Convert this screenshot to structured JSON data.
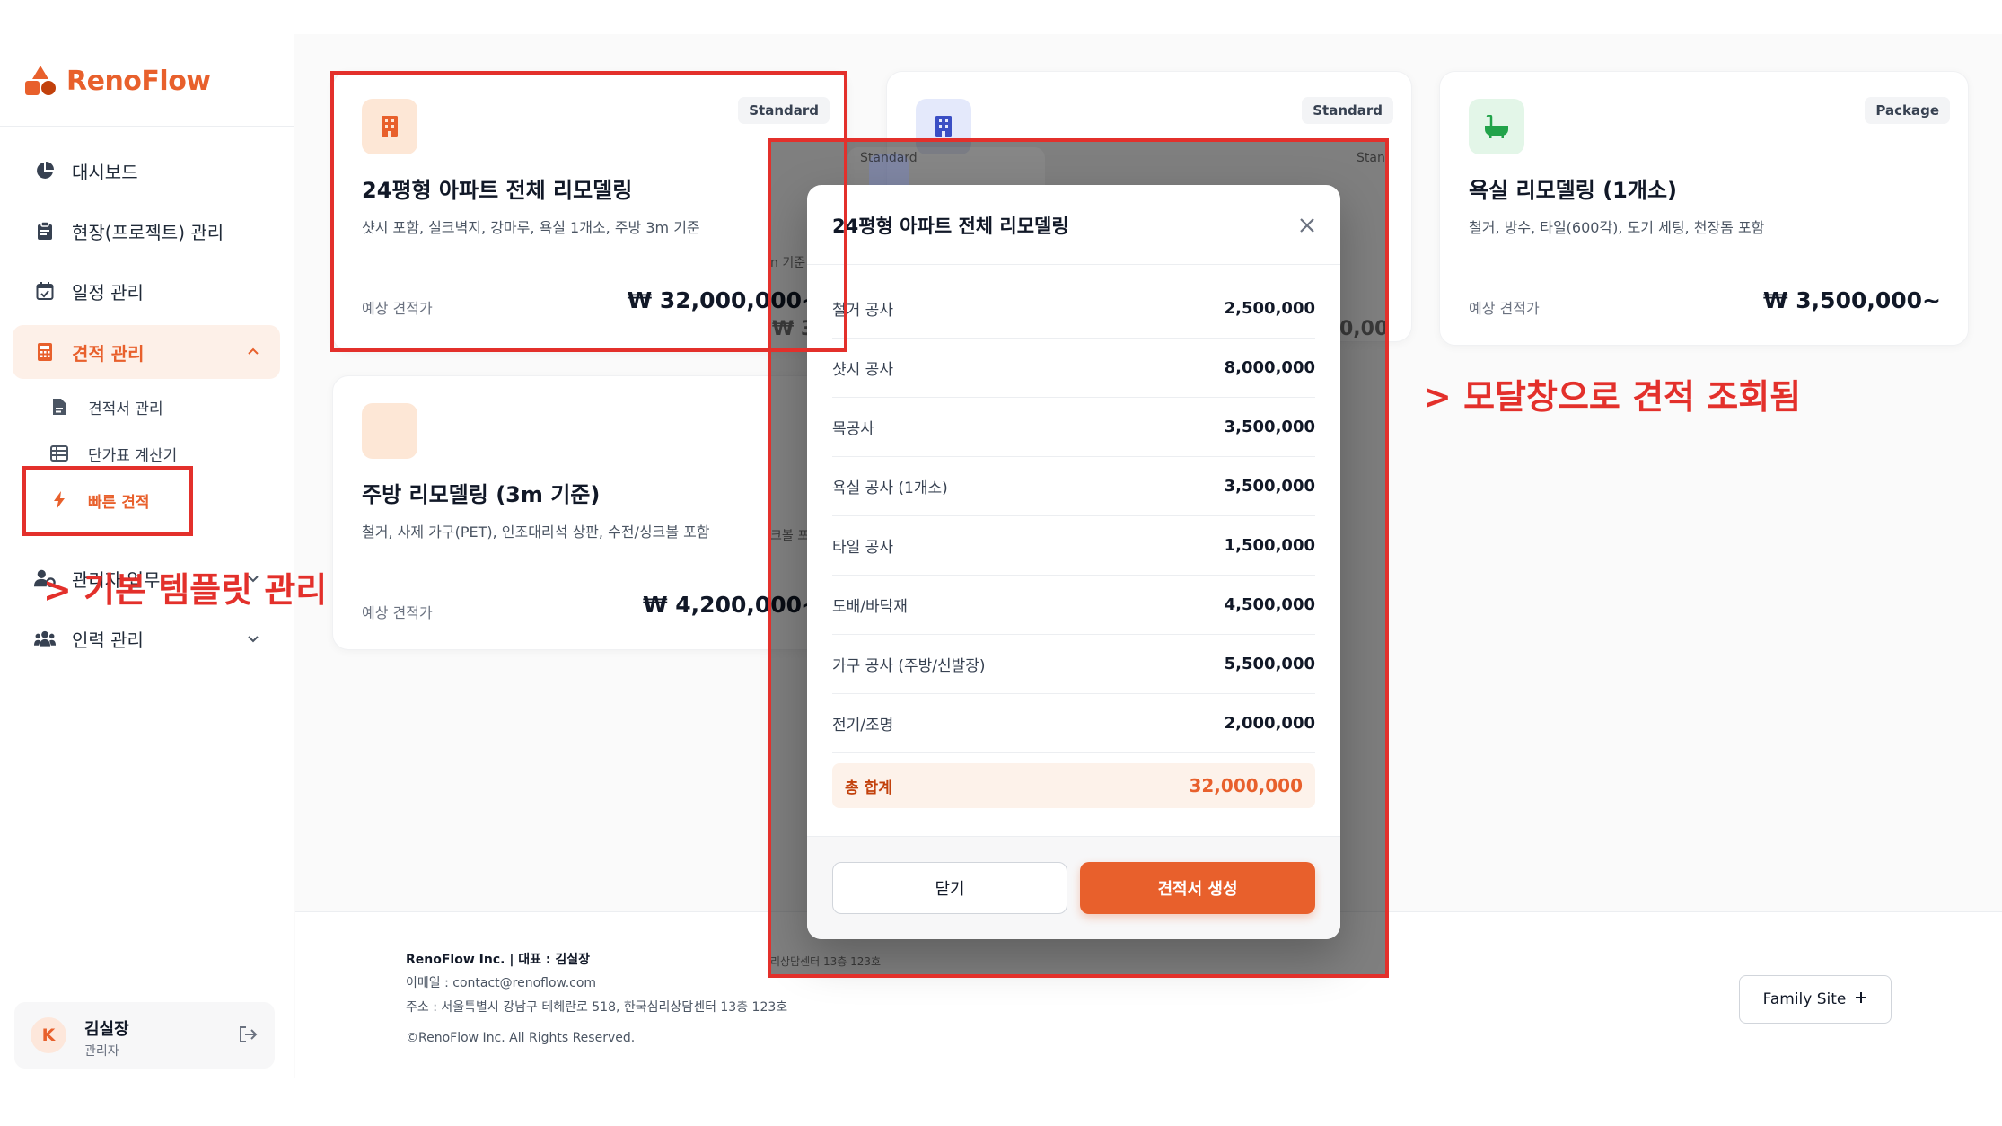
{
  "brand": {
    "name": "RenoFlow"
  },
  "sidebar": {
    "items": [
      {
        "label": "대시보드",
        "icon": "pie-chart-icon"
      },
      {
        "label": "현장(프로젝트) 관리",
        "icon": "clipboard-icon"
      },
      {
        "label": "일정 관리",
        "icon": "calendar-icon"
      },
      {
        "label": "견적 관리",
        "icon": "calculator-icon",
        "expanded": true
      },
      {
        "label": "관리자 업무",
        "icon": "user-gear-icon"
      },
      {
        "label": "인력 관리",
        "icon": "users-icon"
      }
    ],
    "subitems": [
      {
        "label": "견적서 관리",
        "icon": "document-icon"
      },
      {
        "label": "단가표 계산기",
        "icon": "table-icon"
      },
      {
        "label": "빠른 견적",
        "icon": "bolt-icon",
        "active": true
      }
    ],
    "user": {
      "initial": "K",
      "name": "김실장",
      "role": "관리자"
    }
  },
  "cards": [
    {
      "badge": "Standard",
      "title": "24평형 아파트 전체 리모델링",
      "desc": "샷시 포함, 실크벽지, 강마루, 욕실 1개소, 주방 3m 기준",
      "price_label": "예상 견적가",
      "price": "₩ 32,000,000~",
      "icon": "building-icon"
    },
    {
      "badge": "Standard",
      "title": "",
      "desc": "",
      "price_label": "",
      "price": "",
      "icon": "building-icon"
    },
    {
      "badge": "Package",
      "title": "욕실 리모델링 (1개소)",
      "desc": "철거, 방수, 타일(600각), 도기 세팅, 천장돔 포함",
      "price_label": "예상 견적가",
      "price": "₩ 3,500,000~",
      "icon": "bathtub-icon"
    },
    {
      "badge": "",
      "title": "주방 리모델링 (3m 기준)",
      "desc": "철거, 사제 가구(PET), 인조대리석 상판, 수전/싱크볼 포함",
      "price_label": "예상 견적가",
      "price": "₩ 4,200,000~",
      "icon": ""
    }
  ],
  "footer": {
    "company": "RenoFlow Inc. | 대표 : 김실장",
    "email": "이메일 : contact@renoflow.com",
    "address": "주소 : 서울특별시 강남구 테헤란로 518, 한국심리상담센터 13층 123호",
    "copyright": "©RenoFlow Inc. All Rights Reserved.",
    "family_site": "Family Site"
  },
  "ghost_text": {
    "badge_left": "Standard",
    "badge_right": "Stan",
    "frag1": "n 기준",
    "frag2": "₩ 3",
    "frag3": "0,00",
    "frag4": "크볼 포",
    "frag5": "리상담센터 13층 123호"
  },
  "modal": {
    "title": "24평형 아파트 전체 리모델링",
    "items": [
      {
        "name": "철거 공사",
        "amount": "2,500,000"
      },
      {
        "name": "샷시 공사",
        "amount": "8,000,000"
      },
      {
        "name": "목공사",
        "amount": "3,500,000"
      },
      {
        "name": "욕실 공사 (1개소)",
        "amount": "3,500,000"
      },
      {
        "name": "타일 공사",
        "amount": "1,500,000"
      },
      {
        "name": "도배/바닥재",
        "amount": "4,500,000"
      },
      {
        "name": "가구 공사 (주방/신발장)",
        "amount": "5,500,000"
      },
      {
        "name": "전기/조명",
        "amount": "2,000,000"
      }
    ],
    "total_label": "총 합계",
    "total_amount": "32,000,000",
    "close_label": "닫기",
    "create_label": "견적서 생성"
  },
  "annotations": {
    "left": "> 기본 템플릿 관리",
    "right": "> 모달창으로 견적 조회됨",
    "color": "#e3302b"
  },
  "colors": {
    "accent": "#e8602c",
    "accent_soft": "#fdf0e8"
  }
}
